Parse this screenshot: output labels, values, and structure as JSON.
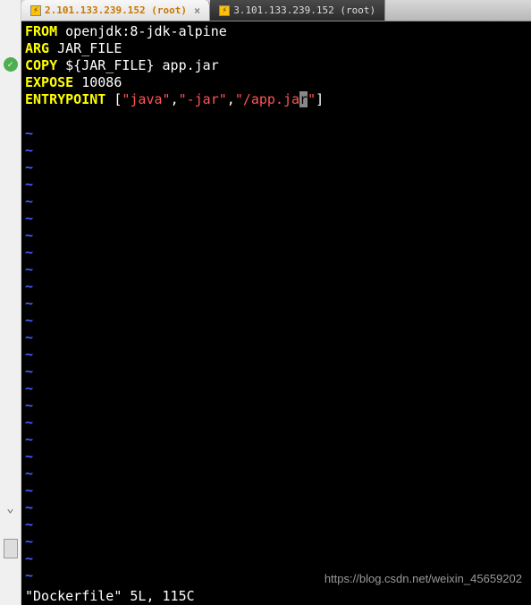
{
  "tabs": [
    {
      "index": "2.",
      "label": "101.133.239.152 (root)"
    },
    {
      "index": "3.",
      "label": "101.133.239.152 (root)"
    }
  ],
  "close_glyph": "×",
  "code": {
    "line1_kw": "FROM",
    "line1_txt": " openjdk:8-jdk-alpine",
    "line2_kw": "ARG",
    "line2_txt": " JAR_FILE",
    "line3_kw": "COPY",
    "line3_txt": " ${JAR_FILE} app.jar",
    "line4_kw": "EXPOSE",
    "line4_txt": " 10086",
    "line5_kw": "ENTRYPOINT",
    "line5_b1": " [",
    "line5_s1": "\"java\"",
    "line5_c1": ",",
    "line5_s2": "\"-jar\"",
    "line5_c2": ",",
    "line5_s3a": "\"/app.ja",
    "line5_cursor": "r",
    "line5_s3b": "\"",
    "line5_b2": "]"
  },
  "tilde": "~",
  "status": "\"Dockerfile\" 5L, 115C",
  "watermark": "https://blog.csdn.net/weixin_45659202",
  "check_glyph": "✓",
  "arrow_glyph": "⌄"
}
